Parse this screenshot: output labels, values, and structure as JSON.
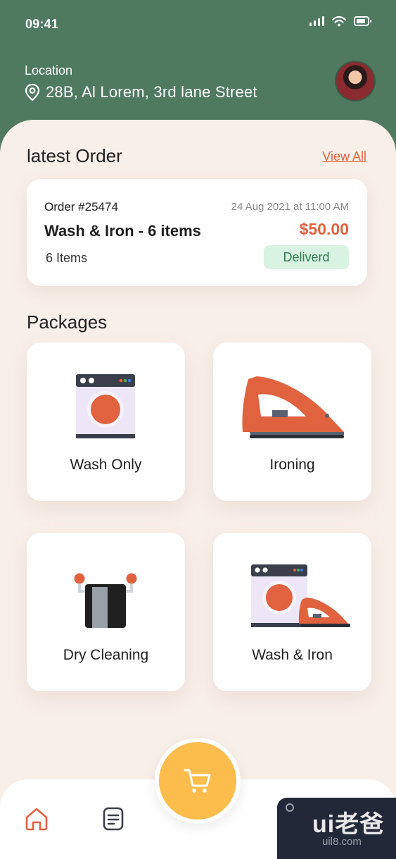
{
  "status_bar": {
    "time": "09:41"
  },
  "header": {
    "location_label": "Location",
    "address": "28B, Al Lorem, 3rd lane Street"
  },
  "latest_order": {
    "title": "latest Order",
    "view_all": "View All",
    "order_id": "Order #25474",
    "date": "24 Aug 2021 at 11:00 AM",
    "name": "Wash & Iron - 6 items",
    "price": "$50.00",
    "items": "6 Items",
    "status": "Deliverd"
  },
  "packages": {
    "title": "Packages",
    "items": [
      {
        "label": "Wash Only",
        "icon": "washing-machine-icon"
      },
      {
        "label": "Ironing",
        "icon": "iron-icon"
      },
      {
        "label": "Dry Cleaning",
        "icon": "towel-rack-icon"
      },
      {
        "label": "Wash & Iron",
        "icon": "washer-and-iron-icon"
      }
    ]
  },
  "nav": {
    "items": [
      "home-icon",
      "orders-icon",
      "cart-icon"
    ]
  },
  "watermark": {
    "logo": "ui老爸",
    "url": "uil8.com"
  },
  "colors": {
    "header_bg": "#4f7a60",
    "content_bg": "#f9efe9",
    "accent": "#e0623f",
    "cart": "#fcbd4c",
    "status_bg": "#d9f3e3",
    "status_text": "#2f7a4f"
  }
}
